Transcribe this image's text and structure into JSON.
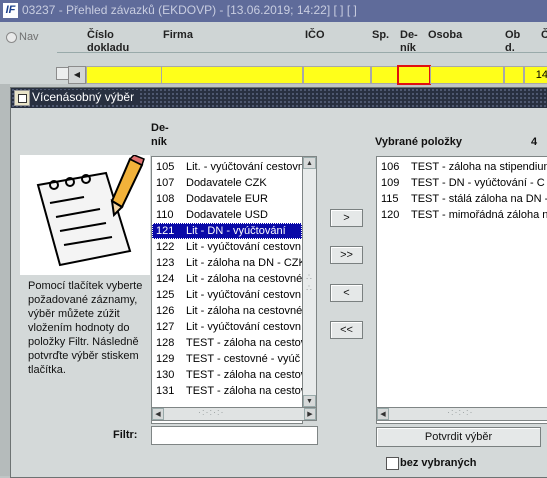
{
  "app": {
    "logo": "IF",
    "title": "03237 - Přehled závazků (EKDOVP) - [13.06.2019; 14:22]  [ ]  [ ]",
    "nav_label": "Nav",
    "columns": {
      "cislo_dokladu": "Číslo dokladu",
      "firma": "Firma",
      "ico": "IČO",
      "sp": "Sp.",
      "denik": "De- ník",
      "osoba": "Osoba",
      "ob": "Ob d.",
      "last": "Č"
    },
    "last_cell_value": "14"
  },
  "dialog": {
    "title": "Vícenásobný výběr",
    "denik_header": "De- ník",
    "help_text": "Pomocí tlačítek vyberte požadované záznamy, výběr můžete zúžit vložením hodnoty do položky Filtr. Následně potvrďte výběr stiskem tlačítka.",
    "available_items": [
      {
        "code": "105",
        "name": "Lit. - vyúčtování cestovn"
      },
      {
        "code": "107",
        "name": "Dodavatele CZK"
      },
      {
        "code": "108",
        "name": "Dodavatele EUR"
      },
      {
        "code": "110",
        "name": "Dodavatele USD"
      },
      {
        "code": "121",
        "name": "Lit - DN - vyúčtování"
      },
      {
        "code": "122",
        "name": "Lit - vyúčtování cestovn"
      },
      {
        "code": "123",
        "name": "Lit - záloha na DN - CZK"
      },
      {
        "code": "124",
        "name": "Lit - záloha na cestovné"
      },
      {
        "code": "125",
        "name": "Lit - vyúčtování cestovn"
      },
      {
        "code": "126",
        "name": "Lit - záloha na cestovné"
      },
      {
        "code": "127",
        "name": "Lit - vyúčtování cestovn"
      },
      {
        "code": "128",
        "name": "TEST - záloha na cestov"
      },
      {
        "code": "129",
        "name": "TEST - cestovné - vyúč"
      },
      {
        "code": "130",
        "name": "TEST - záloha na cestov"
      },
      {
        "code": "131",
        "name": "TEST - záloha na cestov"
      }
    ],
    "selected_available_index": 4,
    "buttons": {
      "move_one": ">",
      "move_all": ">>",
      "back_one": "<",
      "back_all": "<<"
    },
    "chosen_header": "Vybrané položky",
    "chosen_count": "4",
    "chosen_items": [
      {
        "code": "106",
        "name": "TEST - záloha na stipendium"
      },
      {
        "code": "109",
        "name": "TEST - DN - vyúčtování - C"
      },
      {
        "code": "115",
        "name": "TEST - stálá záloha na DN -"
      },
      {
        "code": "120",
        "name": "TEST - mimořádná záloha n"
      }
    ],
    "filter_label": "Filtr:",
    "filter_value": "",
    "confirm_button": "Potvrdit výběr",
    "without_selected_label": "bez vybraných",
    "without_selected_checked": false
  }
}
